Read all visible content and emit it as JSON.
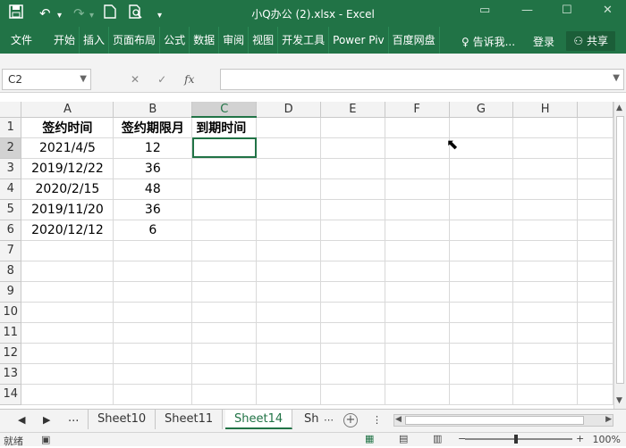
{
  "window": {
    "title": "小Q办公 (2).xlsx  -  Excel"
  },
  "quick_access": {
    "save_icon": "save-icon",
    "undo_icon": "undo-icon",
    "redo_icon": "redo-icon",
    "new_icon": "new-doc-icon",
    "preview_icon": "print-preview-icon",
    "customize_icon": "customize-icon"
  },
  "ribbon": {
    "tabs": [
      "文件",
      "开始",
      "插入",
      "页面布局",
      "公式",
      "数据",
      "审阅",
      "视图",
      "开发工具",
      "Power Piv",
      "百度网盘"
    ],
    "tell_me": "告诉我...",
    "login": "登录",
    "share": "共享"
  },
  "formula_bar": {
    "name_box": "C2",
    "formula": ""
  },
  "sheet": {
    "columns": [
      "A",
      "B",
      "C",
      "D",
      "E",
      "F",
      "G",
      "H"
    ],
    "rows": [
      "1",
      "2",
      "3",
      "4",
      "5",
      "6",
      "7",
      "8",
      "9",
      "10",
      "11",
      "12",
      "13",
      "14"
    ],
    "cells": {
      "A1": "签约时间",
      "B1": "签约期限月",
      "C1": "到期时间",
      "A2": "2021/4/5",
      "B2": "12",
      "A3": "2019/12/22",
      "B3": "36",
      "A4": "2020/2/15",
      "B4": "48",
      "A5": "2019/11/20",
      "B5": "36",
      "A6": "2020/12/12",
      "B6": "6"
    },
    "selected_cell": "C2"
  },
  "sheet_tabs": {
    "ellipsis": "...",
    "tabs": [
      "Sheet10",
      "Sheet11",
      "Sheet14",
      "Sh"
    ],
    "active": "Sheet14"
  },
  "status": {
    "text": "就绪",
    "zoom": "100%"
  },
  "colors": {
    "excel_green": "#217346"
  }
}
